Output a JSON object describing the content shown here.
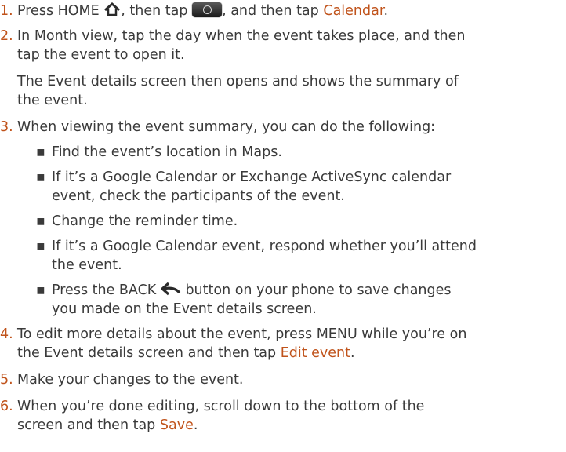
{
  "steps": [
    {
      "num": "1.",
      "pre": "Press HOME",
      "mid1": ", then tap",
      "mid2": ", and then tap",
      "link": "Calendar",
      "end": "."
    },
    {
      "num": "2.",
      "line1": "In Month view, tap the day when the event takes place, and then",
      "line2": "tap the event to open it."
    },
    {
      "para_line1": "The Event details screen then opens and shows the summary of",
      "para_line2": "the event."
    },
    {
      "num": "3.",
      "text": "When viewing the event summary, you can do the following:"
    },
    {
      "num": "4.",
      "line1": "To edit more details about the event, press MENU while you’re on",
      "line2_pre": "the Event details screen and then tap",
      "link": "Edit event",
      "end": "."
    },
    {
      "num": "5.",
      "text": "Make your changes to the event."
    },
    {
      "num": "6.",
      "line1": "When you’re done editing, scroll down to the bottom of the",
      "line2_pre": "screen and then tap",
      "link": "Save",
      "end": "."
    }
  ],
  "bullets": [
    {
      "line1": "Find the event’s location in Maps."
    },
    {
      "line1": "If it’s a Google Calendar or Exchange ActiveSync calendar",
      "line2": "event, check the participants of the event."
    },
    {
      "line1": "Change the reminder time."
    },
    {
      "line1": "If it’s a Google Calendar event, respond whether you’ll attend",
      "line2": "the event."
    },
    {
      "line1_pre": "Press the BACK",
      "line1_post": "button on your phone to save changes",
      "line2": "you made on the Event details screen."
    }
  ],
  "bullet_char": "▪",
  "colors": {
    "step_number": "#c0531b",
    "link": "#c0531b",
    "text": "#3a3a3a"
  },
  "icons": [
    "home-icon",
    "app-launcher-icon",
    "back-arrow-icon"
  ]
}
